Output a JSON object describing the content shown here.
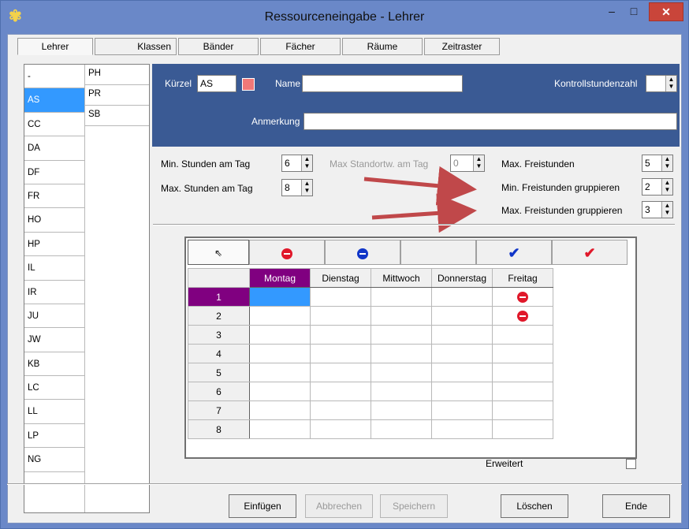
{
  "window": {
    "title": "Ressourceneingabe - Lehrer",
    "icon": "app-logo-icon",
    "controls": {
      "minimize": "–",
      "maximize": "□",
      "close": "✕"
    }
  },
  "tabs": [
    "Lehrer",
    "Klassen",
    "Bänder",
    "Fächer",
    "Räume",
    "Zeitraster"
  ],
  "active_tab": "Lehrer",
  "teacher_list": {
    "col1": [
      "-",
      "AS",
      "CC",
      "DA",
      "DF",
      "FR",
      "HO",
      "HP",
      "IL",
      "IR",
      "JU",
      "JW",
      "KB",
      "LC",
      "LL",
      "LP",
      "NG"
    ],
    "col2": [
      "PH",
      "PR",
      "SB"
    ],
    "selected": "AS"
  },
  "header": {
    "kuerzel_label": "Kürzel",
    "kuerzel_value": "AS",
    "name_label": "Name",
    "name_value": "",
    "kontroll_label": "Kontrollstundenzahl",
    "kontroll_value": "",
    "anmerkung_label": "Anmerkung",
    "anmerkung_value": "",
    "accent_color": "#3a5a94",
    "swatch_color": "#f07878"
  },
  "settings": {
    "min_stunden_label": "Min. Stunden am Tag",
    "min_stunden_value": "6",
    "max_stunden_label": "Max. Stunden am Tag",
    "max_stunden_value": "8",
    "max_standort_label": "Max Standortw. am Tag",
    "max_standort_value": "0",
    "max_frei_label": "Max. Freistunden",
    "max_frei_value": "5",
    "min_frei_grp_label": "Min. Freistunden gruppieren",
    "min_frei_grp_value": "2",
    "max_frei_grp_label": "Max. Freistunden gruppieren",
    "max_frei_grp_value": "3"
  },
  "toolbar": {
    "tools": [
      "pointer-icon",
      "red-block-icon",
      "blue-block-icon",
      "empty",
      "blue-check-icon",
      "red-check-icon"
    ],
    "selected": "pointer-icon"
  },
  "timetable": {
    "days": [
      "Montag",
      "Dienstag",
      "Mittwoch",
      "Donnerstag",
      "Freitag"
    ],
    "selected_day": "Montag",
    "periods": [
      "1",
      "2",
      "3",
      "4",
      "5",
      "6",
      "7",
      "8"
    ],
    "selected_period": "1",
    "blocked": [
      {
        "period": "1",
        "day": "Freitag",
        "icon": "red-block-icon"
      },
      {
        "period": "2",
        "day": "Freitag",
        "icon": "red-block-icon"
      }
    ]
  },
  "erweitert": {
    "label": "Erweitert",
    "checked": false
  },
  "buttons": {
    "einfuegen": "Einfügen",
    "abbrechen": "Abbrechen",
    "speichern": "Speichern",
    "loeschen": "Löschen",
    "ende": "Ende"
  }
}
